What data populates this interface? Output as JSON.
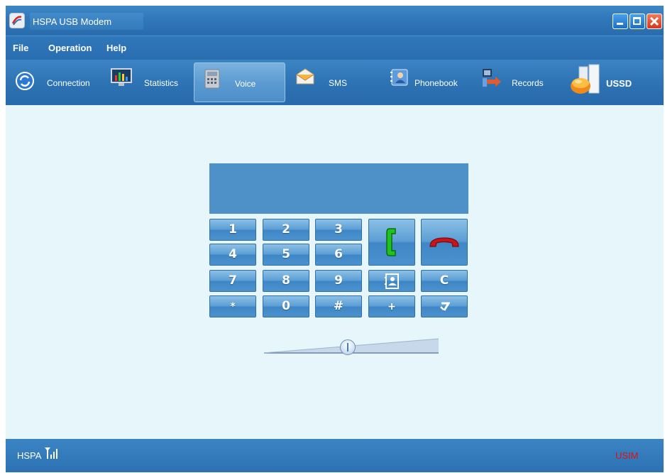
{
  "window": {
    "title": "HSPA USB Modem",
    "controls": [
      "minimize",
      "maximize",
      "close"
    ]
  },
  "menu": [
    {
      "label": "File"
    },
    {
      "label": "Operation"
    },
    {
      "label": "Help"
    }
  ],
  "toolbar": [
    {
      "label": "Connection",
      "icon": "connection-icon",
      "active": false
    },
    {
      "label": "Statistics",
      "icon": "statistics-icon",
      "active": false
    },
    {
      "label": "Voice",
      "icon": "voice-icon",
      "active": true
    },
    {
      "label": "SMS",
      "icon": "sms-icon",
      "active": false
    },
    {
      "label": "Phonebook",
      "icon": "phonebook-icon",
      "active": false
    },
    {
      "label": "Records",
      "icon": "records-icon",
      "active": false
    },
    {
      "label": "USSD",
      "icon": "ussd-icon",
      "active": false
    }
  ],
  "dialer": {
    "display_text": "",
    "keys": {
      "k1": "1",
      "k2": "2",
      "k3": "3",
      "k4": "4",
      "k5": "5",
      "k6": "6",
      "k7": "7",
      "k8": "8",
      "k9": "9",
      "star": "*",
      "k0": "0",
      "hash": "#",
      "clear": "C",
      "plus": "+"
    },
    "action_icons": [
      "call-icon",
      "hangup-icon",
      "contacts-icon",
      "backspace-icon"
    ]
  },
  "volume": {
    "level": 0.48
  },
  "status": {
    "network": "HSPA",
    "signal_icon": "signal-strength-icon",
    "sim": "USIM"
  },
  "colors": {
    "chrome_blue": "#2f76b8",
    "content_bg": "#e6f6fb",
    "display_blue": "#4e91c8",
    "sim_red": "#e01010",
    "call_green": "#1fc21f",
    "hangup_red": "#c8151b"
  }
}
